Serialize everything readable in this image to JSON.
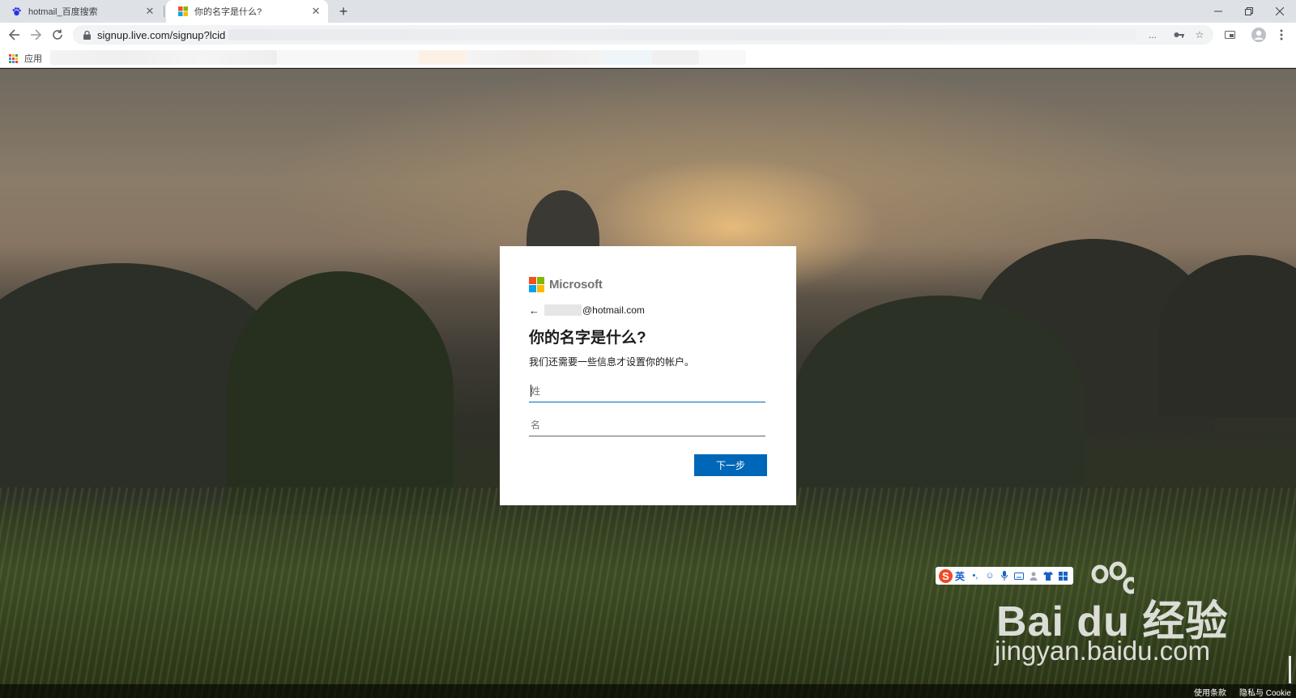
{
  "tabs": [
    {
      "title": "hotmail_百度搜索",
      "favicon": "baidu-paw-icon",
      "active": false
    },
    {
      "title": "你的名字是什么?",
      "favicon": "microsoft-logo-icon",
      "active": true
    }
  ],
  "toolbar": {
    "url": "signup.live.com/signup?lcid",
    "url_ellipsis": "..."
  },
  "bookmarks": {
    "apps_label": "应用"
  },
  "card": {
    "brand": "Microsoft",
    "email_suffix": "@hotmail.com",
    "heading": "你的名字是什么?",
    "subtext": "我们还需要一些信息才设置你的帐户。",
    "last_name_placeholder": "姓",
    "first_name_placeholder": "名",
    "next_label": "下一步"
  },
  "ime": {
    "logo": "S",
    "lang": "英"
  },
  "watermark": {
    "brand": "Bai du 经验",
    "url": "jingyan.baidu.com"
  },
  "footer": {
    "terms": "使用条款",
    "privacy": "隐私与 Cookie"
  },
  "colors": {
    "accent": "#0067b8",
    "ms_red": "#f25022",
    "ms_green": "#7fba00",
    "ms_blue": "#00a4ef",
    "ms_yellow": "#ffb900"
  }
}
